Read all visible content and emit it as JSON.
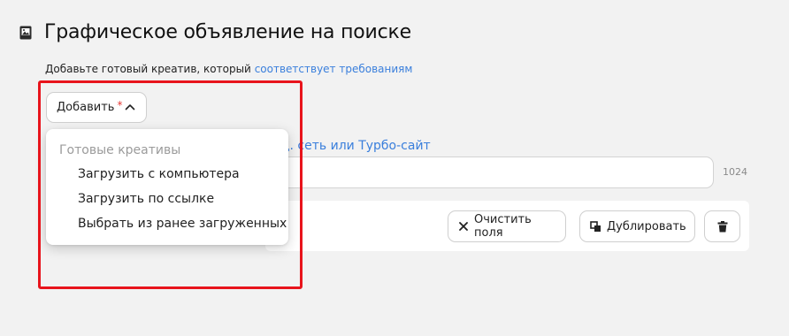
{
  "header": {
    "icon": "image-icon",
    "title": "Графическое объявление на поиске",
    "subtitle_text": "Добавьте готовый креатив, который",
    "subtitle_link": "соответствует требованиям"
  },
  "add_button": {
    "label": "Добавить",
    "required_mark": "*",
    "icon": "chevron-up-icon"
  },
  "background_form": {
    "link_text": "ц. сеть или Турбо-сайт",
    "input_value": "",
    "char_limit": "1024"
  },
  "actions": {
    "clear_label": "Очистить поля",
    "duplicate_label": "Дублировать",
    "delete_icon": "trash-icon"
  },
  "dropdown": {
    "group_label": "Готовые креативы",
    "items": [
      {
        "label": "Загрузить с компьютера"
      },
      {
        "label": "Загрузить по ссылке"
      },
      {
        "label": "Выбрать из ранее загруженных"
      }
    ]
  },
  "colors": {
    "link": "#3a7fdc",
    "highlight": "#e8141c",
    "required": "#e53935",
    "background": "#f2f2f2"
  }
}
